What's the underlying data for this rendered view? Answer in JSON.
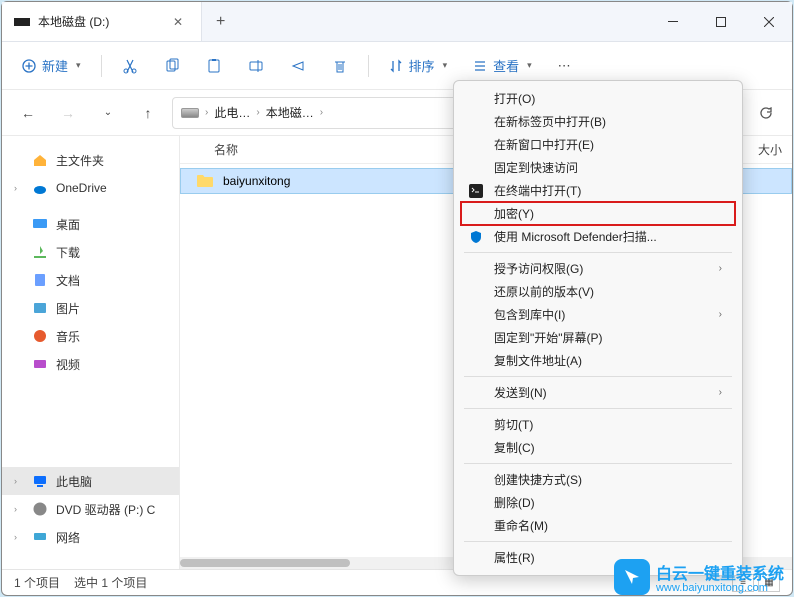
{
  "window": {
    "tab_title": "本地磁盘 (D:)"
  },
  "toolbar": {
    "new_label": "新建",
    "sort_label": "排序",
    "view_label": "查看"
  },
  "breadcrumb": {
    "seg1": "此电…",
    "seg2": "本地磁…"
  },
  "columns": {
    "name": "名称",
    "size": "大小"
  },
  "files": [
    {
      "name": "baiyunxitong",
      "type": "folder"
    }
  ],
  "sidebar": {
    "home": "主文件夹",
    "onedrive": "OneDrive",
    "desktop": "桌面",
    "downloads": "下载",
    "documents": "文档",
    "pictures": "图片",
    "music": "音乐",
    "videos": "视频",
    "thispc": "此电脑",
    "dvd": "DVD 驱动器 (P:) C",
    "network": "网络"
  },
  "context_menu": {
    "open": "打开(O)",
    "open_new_tab": "在新标签页中打开(B)",
    "open_new_window": "在新窗口中打开(E)",
    "pin_quick": "固定到快速访问",
    "open_terminal": "在终端中打开(T)",
    "encrypt": "加密(Y)",
    "defender_scan": "使用 Microsoft Defender扫描...",
    "give_access": "授予访问权限(G)",
    "restore_prev": "还原以前的版本(V)",
    "include_library": "包含到库中(I)",
    "pin_start": "固定到\"开始\"屏幕(P)",
    "copy_path": "复制文件地址(A)",
    "send_to": "发送到(N)",
    "cut": "剪切(T)",
    "copy": "复制(C)",
    "create_shortcut": "创建快捷方式(S)",
    "delete": "删除(D)",
    "rename": "重命名(M)",
    "properties": "属性(R)"
  },
  "status": {
    "count": "1 个项目",
    "selected": "选中 1 个项目"
  },
  "watermark": {
    "title": "白云一键重装系统",
    "url": "www.baiyunxitong.com"
  }
}
